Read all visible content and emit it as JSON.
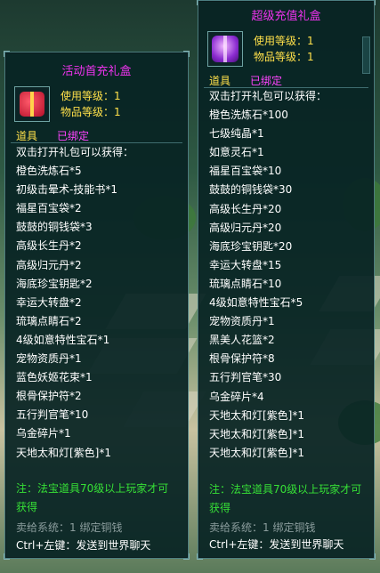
{
  "panel_left": {
    "title": "活动首充礼盒",
    "level_label": "使用等级：",
    "level_value": "1",
    "item_level_label": "物品等级：",
    "item_level_value": "1",
    "category": "道具",
    "bound": "已绑定",
    "intro": "双击打开礼包可以获得：",
    "items": [
      "橙色洗炼石*5",
      "初级击晕术-技能书*1",
      "福星百宝袋*2",
      "鼓鼓的铜钱袋*3",
      "高级长生丹*2",
      "高级归元丹*2",
      "海底珍宝钥匙*2",
      "幸运大转盘*2",
      "琉璃点睛石*2",
      "4级如意特性宝石*1",
      "宠物资质丹*1",
      "蓝色妖姬花束*1",
      "根骨保护符*2",
      "五行判官笔*10",
      "乌金碎片*1",
      "天地太和灯[紫色]*1"
    ],
    "note_line1": "注：法宝道具70级以上玩家才可",
    "note_line2": "获得",
    "sell": "卖给系统：1 绑定铜钱",
    "ctrl": "Ctrl+左键：发送到世界聊天"
  },
  "panel_right": {
    "title": "超级充值礼盒",
    "level_label": "使用等级：",
    "level_value": "1",
    "item_level_label": "物品等级：",
    "item_level_value": "1",
    "category": "道具",
    "bound": "已绑定",
    "intro": "双击打开礼包可以获得：",
    "items": [
      "橙色洗炼石*100",
      "七级纯晶*1",
      "如意灵石*1",
      "福星百宝袋*10",
      "鼓鼓的铜钱袋*30",
      "高级长生丹*20",
      "高级归元丹*20",
      "海底珍宝钥匙*20",
      "幸运大转盘*15",
      "琉璃点睛石*10",
      "4级如意特性宝石*5",
      "宠物资质丹*1",
      "黑美人花篮*2",
      "根骨保护符*8",
      "五行判官笔*30",
      "乌金碎片*4",
      "天地太和灯[紫色]*1",
      "天地太和灯[紫色]*1",
      "天地太和灯[紫色]*1"
    ],
    "note_line1": "注：法宝道具70级以上玩家才可",
    "note_line2": "获得",
    "sell": "卖给系统：1 绑定铜钱",
    "ctrl": "Ctrl+左键：发送到世界聊天"
  },
  "colors": {
    "title": "#ee33ee",
    "meta": "#ffe04a",
    "bound": "#ff44ff",
    "note": "#36e036",
    "sell": "#8b9d9d"
  }
}
